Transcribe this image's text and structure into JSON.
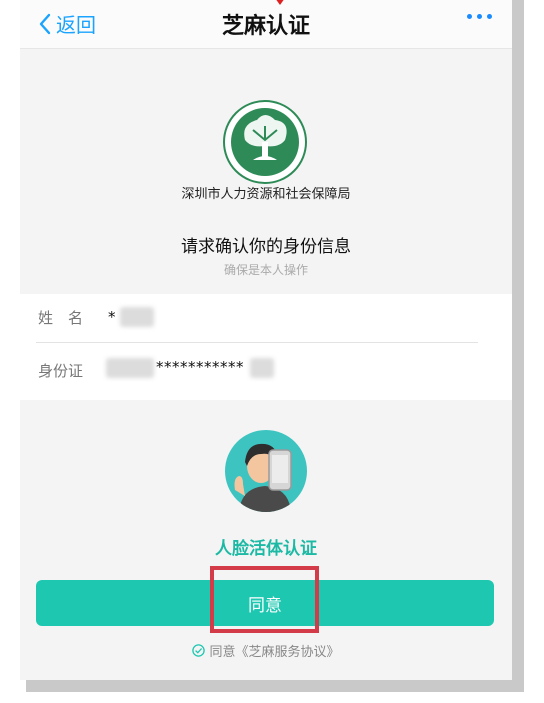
{
  "nav": {
    "back_label": "返回",
    "title": "芝麻认证"
  },
  "org": {
    "name": "深圳市人力资源和社会保障局"
  },
  "confirm": {
    "title": "请求确认你的身份信息",
    "subtitle": "确保是本人操作"
  },
  "identity": {
    "name_label": "姓　名",
    "name_value": "*",
    "id_label": "身份证",
    "id_value": "***********"
  },
  "face": {
    "title": "人脸活体认证"
  },
  "actions": {
    "agree_label": "同意",
    "agreement_text": "同意《芝麻服务协议》"
  },
  "colors": {
    "accent": "#1ec7b0",
    "link_blue": "#1aa3ff",
    "highlight_red": "#d33b48",
    "logo_green": "#2e8b57"
  }
}
